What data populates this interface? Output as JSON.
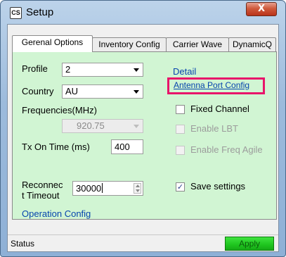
{
  "window": {
    "title": "Setup",
    "icon": "CS",
    "close_glyph": "X"
  },
  "tabs": [
    {
      "label": "Gerenal Options",
      "active": true
    },
    {
      "label": "Inventory Config",
      "active": false
    },
    {
      "label": "Carrier Wave",
      "active": false
    },
    {
      "label": "DynamicQ",
      "active": false
    }
  ],
  "form": {
    "profile_label": "Profile",
    "profile_value": "2",
    "country_label": "Country",
    "country_value": "AU",
    "frequencies_label": "Frequencies(MHz)",
    "frequency_value": "920.75",
    "tx_on_time_label": "Tx On Time (ms)",
    "tx_on_time_value": "400",
    "reconnect_label_line1": "Reconnec",
    "reconnect_label_line2": "t Timeout",
    "reconnect_value": "30000",
    "operation_config_link": "Operation Config"
  },
  "right_column": {
    "detail_link": "Detail",
    "antenna_port_config_link": "Antenna Port Config",
    "fixed_channel_label": "Fixed Channel",
    "fixed_channel_checked": false,
    "enable_lbt_label": "Enable LBT",
    "enable_freq_agile_label": "Enable Freq Agile",
    "save_settings_label": "Save settings",
    "save_settings_checked": true,
    "check_glyph": "✓"
  },
  "status": {
    "text": "Status",
    "apply_label": "Apply"
  },
  "colors": {
    "panel_green": "#d1f5d3",
    "link_blue": "#0645ad",
    "highlight_pink": "#e8156a",
    "apply_green": "#1ec41e"
  }
}
